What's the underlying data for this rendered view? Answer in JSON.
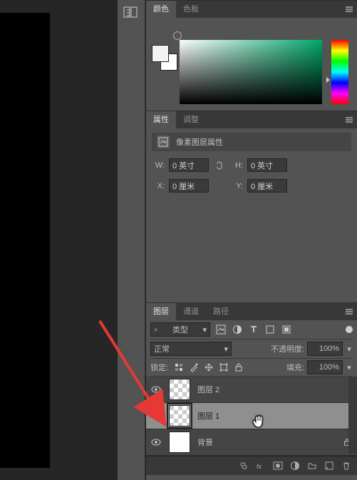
{
  "color_panel": {
    "tabs": [
      "颜色",
      "色板"
    ],
    "active_tab": "颜色"
  },
  "properties_panel": {
    "tabs": [
      "属性",
      "调整"
    ],
    "active_tab": "属性",
    "title": "像素图层属性",
    "width_label": "W:",
    "height_label": "H:",
    "x_label": "X:",
    "y_label": "Y:",
    "width_value": "0 英寸",
    "height_value": "0 英寸",
    "x_value": "0 厘米",
    "y_value": "0 厘米"
  },
  "layers_panel": {
    "tabs": [
      "图层",
      "通道",
      "路径"
    ],
    "active_tab": "图层",
    "filter_label": "类型",
    "blend_mode": "正常",
    "opacity_label": "不透明度:",
    "opacity_value": "100%",
    "lock_label": "锁定:",
    "fill_label": "填充:",
    "fill_value": "100%",
    "layers": [
      {
        "name": "图层 2",
        "visible": true,
        "selected": false,
        "locked": false,
        "checker": true
      },
      {
        "name": "图层 1",
        "visible": true,
        "selected": true,
        "locked": false,
        "checker": true
      },
      {
        "name": "背景",
        "visible": true,
        "selected": false,
        "locked": true,
        "checker": false
      }
    ]
  }
}
